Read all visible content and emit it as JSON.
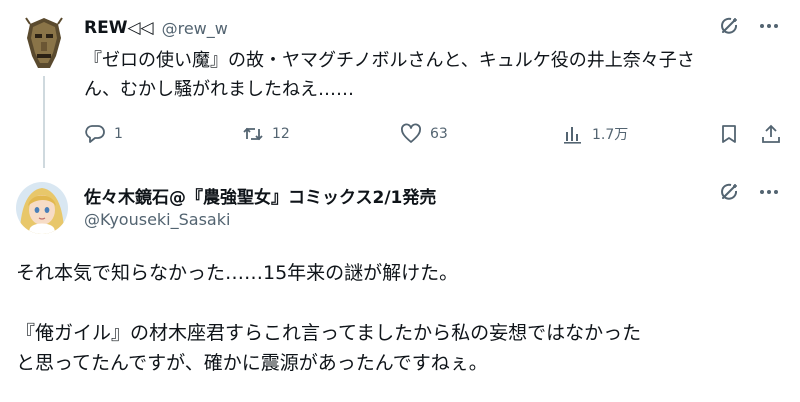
{
  "tweet1": {
    "author_name": "REW◁◁",
    "handle": "@rew_w",
    "text_line1": "『ゼロの使い魔』の故・ヤマグチノボルさんと、キュルケ役の井上奈々子さ",
    "text_line2": "ん、むかし騒がれましたねえ……",
    "replies": "1",
    "reposts": "12",
    "likes": "63",
    "views": "1.7万"
  },
  "tweet2": {
    "author_name": "佐々木鏡石@『農強聖女』コミックス2/1発売",
    "handle": "@Kyouseki_Sasaki",
    "line1": "それ本気で知らなかった……15年来の謎が解けた。",
    "line2": "『俺ガイル』の材木座君すらこれ言ってましたから私の妄想ではなかった",
    "line3": "と思ってたんですが、確かに震源があったんですねぇ。"
  },
  "colors": {
    "text": "#0f1419",
    "secondary": "#536471",
    "thread_line": "#cfd9de"
  },
  "icons": [
    "grok-icon",
    "more-icon",
    "reply-icon",
    "repost-icon",
    "like-icon",
    "views-icon",
    "bookmark-icon",
    "share-icon",
    "avatar-mask-icon",
    "avatar-anime-icon"
  ]
}
